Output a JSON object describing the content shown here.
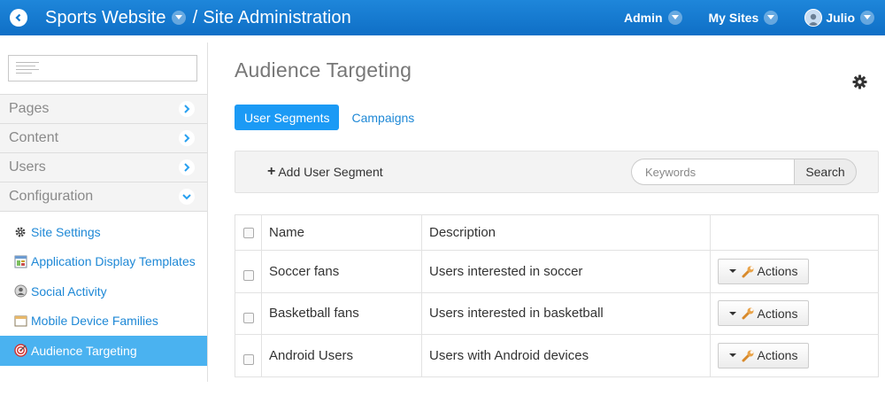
{
  "topbar": {
    "site_name": "Sports Website",
    "separator": "/",
    "section": "Site Administration",
    "admin_label": "Admin",
    "mysites_label": "My Sites",
    "user_name": "Julio"
  },
  "sidebar": {
    "nav": [
      {
        "label": "Pages"
      },
      {
        "label": "Content"
      },
      {
        "label": "Users"
      },
      {
        "label": "Configuration"
      }
    ],
    "sub_items": [
      {
        "label": "Site Settings",
        "icon": "gear-icon"
      },
      {
        "label": "Application Display Templates",
        "icon": "template-icon"
      },
      {
        "label": "Social Activity",
        "icon": "user-circle-icon"
      },
      {
        "label": "Mobile Device Families",
        "icon": "window-icon"
      },
      {
        "label": "Audience Targeting",
        "icon": "target-icon"
      }
    ]
  },
  "main": {
    "title": "Audience Targeting",
    "tabs": [
      {
        "label": "User Segments"
      },
      {
        "label": "Campaigns"
      }
    ],
    "toolbar": {
      "add_plus": "+",
      "add_label": "Add User Segment",
      "search_placeholder": "Keywords",
      "search_button": "Search"
    },
    "table": {
      "headers": [
        "Name",
        "Description",
        ""
      ],
      "rows": [
        {
          "name": "Soccer fans",
          "description": "Users interested in soccer",
          "action": "Actions"
        },
        {
          "name": "Basketball fans",
          "description": "Users interested in basketball",
          "action": "Actions"
        },
        {
          "name": "Android Users",
          "description": "Users with Android devices",
          "action": "Actions"
        }
      ]
    }
  },
  "colors": {
    "topbar": "#1479cf",
    "accent": "#1b9af5",
    "link": "#1e88d6",
    "active_sidebar": "#4ab2f0"
  }
}
